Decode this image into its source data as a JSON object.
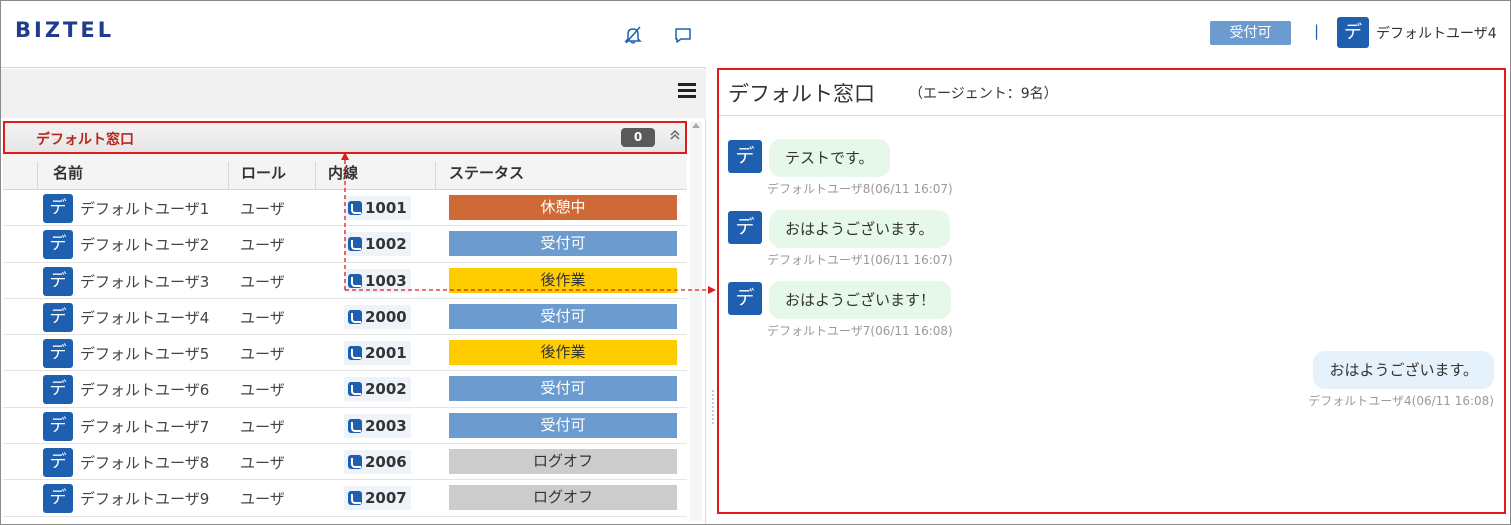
{
  "app": {
    "logo": "BIZTEL"
  },
  "header": {
    "icons": [
      "bell-off-icon",
      "chat-icon"
    ],
    "menu_icon": "hamburger-icon"
  },
  "group": {
    "title": "デフォルト窓口",
    "count": "0"
  },
  "table": {
    "columns": [
      "名前",
      "ロール",
      "内線",
      "ステータス"
    ],
    "rows": [
      {
        "avatar": "デ",
        "name": "デフォルトユーザ1",
        "role": "ユーザ",
        "ext": "1001",
        "status": "休憩中",
        "status_color": "#cf6a36",
        "status_text_color": "#ffffff"
      },
      {
        "avatar": "デ",
        "name": "デフォルトユーザ2",
        "role": "ユーザ",
        "ext": "1002",
        "status": "受付可",
        "status_color": "#6c9ccf",
        "status_text_color": "#ffffff"
      },
      {
        "avatar": "デ",
        "name": "デフォルトユーザ3",
        "role": "ユーザ",
        "ext": "1003",
        "status": "後作業",
        "status_color": "#ffcc00",
        "status_text_color": "#333333"
      },
      {
        "avatar": "デ",
        "name": "デフォルトユーザ4",
        "role": "ユーザ",
        "ext": "2000",
        "status": "受付可",
        "status_color": "#6c9ccf",
        "status_text_color": "#ffffff"
      },
      {
        "avatar": "デ",
        "name": "デフォルトユーザ5",
        "role": "ユーザ",
        "ext": "2001",
        "status": "後作業",
        "status_color": "#ffcc00",
        "status_text_color": "#333333"
      },
      {
        "avatar": "デ",
        "name": "デフォルトユーザ6",
        "role": "ユーザ",
        "ext": "2002",
        "status": "受付可",
        "status_color": "#6c9ccf",
        "status_text_color": "#ffffff"
      },
      {
        "avatar": "デ",
        "name": "デフォルトユーザ7",
        "role": "ユーザ",
        "ext": "2003",
        "status": "受付可",
        "status_color": "#6c9ccf",
        "status_text_color": "#ffffff"
      },
      {
        "avatar": "デ",
        "name": "デフォルトユーザ8",
        "role": "ユーザ",
        "ext": "2006",
        "status": "ログオフ",
        "status_color": "#cccccc",
        "status_text_color": "#333333"
      },
      {
        "avatar": "デ",
        "name": "デフォルトユーザ9",
        "role": "ユーザ",
        "ext": "2007",
        "status": "ログオフ",
        "status_color": "#cccccc",
        "status_text_color": "#333333"
      }
    ]
  },
  "topbar": {
    "status_label": "受付可",
    "separator": "|",
    "user_avatar": "デ",
    "user_name": "デフォルトユーザ4"
  },
  "chat": {
    "title": "デフォルト窓口",
    "subtitle": "（エージェント：9名）",
    "messages": [
      {
        "avatar": "デ",
        "text": "テストです。",
        "meta": "デフォルトユーザ8(06/11 16:07)",
        "mine": false
      },
      {
        "avatar": "デ",
        "text": "おはようございます。",
        "meta": "デフォルトユーザ1(06/11 16:07)",
        "mine": false
      },
      {
        "avatar": "デ",
        "text": "おはようございます！",
        "meta": "デフォルトユーザ7(06/11 16:08)",
        "mine": false
      },
      {
        "avatar": "",
        "text": "おはようございます。",
        "meta": "デフォルトユーザ4(06/11 16:08)",
        "mine": true
      }
    ]
  },
  "colors": {
    "accent_blue": "#1e5fb0",
    "highlight_red": "#e01b1b",
    "group_title": "#b5281c"
  }
}
